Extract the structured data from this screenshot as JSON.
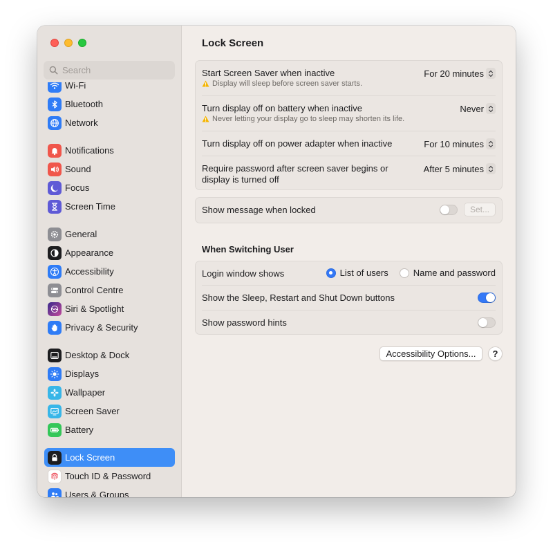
{
  "window": {
    "traffic_lights": [
      "close",
      "minimize",
      "zoom"
    ]
  },
  "search": {
    "placeholder": "Search",
    "value": ""
  },
  "sidebar": {
    "items": [
      {
        "label": "Wi-Fi",
        "icon": "wifi-icon",
        "color": "#2f7cf6"
      },
      {
        "label": "Bluetooth",
        "icon": "bluetooth-icon",
        "color": "#2f7cf6"
      },
      {
        "label": "Network",
        "icon": "globe-icon",
        "color": "#2f7cf6"
      },
      {
        "label": "Notifications",
        "icon": "bell-icon",
        "color": "#f0564b"
      },
      {
        "label": "Sound",
        "icon": "speaker-icon",
        "color": "#f0564b"
      },
      {
        "label": "Focus",
        "icon": "moon-icon",
        "color": "#5f5ad6"
      },
      {
        "label": "Screen Time",
        "icon": "hourglass-icon",
        "color": "#5f5ad6"
      },
      {
        "label": "General",
        "icon": "gear-icon",
        "color": "#8e8e93"
      },
      {
        "label": "Appearance",
        "icon": "appearance-icon",
        "color": "#1d1d1f"
      },
      {
        "label": "Accessibility",
        "icon": "accessibility-icon",
        "color": "#2f7cf6"
      },
      {
        "label": "Control Centre",
        "icon": "control-centre-icon",
        "color": "#8e8e93"
      },
      {
        "label": "Siri & Spotlight",
        "icon": "siri-icon",
        "color": "#7b3fd1"
      },
      {
        "label": "Privacy & Security",
        "icon": "hand-icon",
        "color": "#2f7cf6"
      },
      {
        "label": "Desktop & Dock",
        "icon": "dock-icon",
        "color": "#1d1d1f"
      },
      {
        "label": "Displays",
        "icon": "sun-icon",
        "color": "#2f7cf6"
      },
      {
        "label": "Wallpaper",
        "icon": "flower-icon",
        "color": "#38b6e8"
      },
      {
        "label": "Screen Saver",
        "icon": "screensaver-icon",
        "color": "#38b6e8"
      },
      {
        "label": "Battery",
        "icon": "battery-icon",
        "color": "#34c759"
      },
      {
        "label": "Lock Screen",
        "icon": "lock-icon",
        "color": "#1d1d1f"
      },
      {
        "label": "Touch ID & Password",
        "icon": "fingerprint-icon",
        "color": "#ffffff"
      },
      {
        "label": "Users & Groups",
        "icon": "users-icon",
        "color": "#2f7cf6"
      }
    ],
    "selected": "Lock Screen"
  },
  "page": {
    "title": "Lock Screen"
  },
  "screen_saver_group": {
    "screen_saver": {
      "label": "Start Screen Saver when inactive",
      "value": "For 20 minutes",
      "warning": "Display will sleep before screen saver starts."
    },
    "battery": {
      "label": "Turn display off on battery when inactive",
      "value": "Never",
      "warning": "Never letting your display go to sleep may shorten its life."
    },
    "power_adapter": {
      "label": "Turn display off on power adapter when inactive",
      "value": "For 10 minutes"
    },
    "require_password": {
      "label_line1": "Require password after screen saver begins or",
      "label_line2": "display is turned off",
      "value": "After 5 minutes"
    }
  },
  "message_group": {
    "label": "Show message when locked",
    "enabled": false,
    "set_button": "Set..."
  },
  "switching_user": {
    "title": "When Switching User",
    "login_window": {
      "label": "Login window shows",
      "options": [
        "List of users",
        "Name and password"
      ],
      "selected": "List of users"
    },
    "sleep_restart": {
      "label": "Show the Sleep, Restart and Shut Down buttons",
      "enabled": true
    },
    "password_hints": {
      "label": "Show password hints",
      "enabled": false
    }
  },
  "footer": {
    "accessibility_options": "Accessibility Options...",
    "help": "?"
  },
  "colors": {
    "accent": "#3478f6",
    "sidebar_selection": "#3e8ef7",
    "warning": "#f5b500"
  }
}
